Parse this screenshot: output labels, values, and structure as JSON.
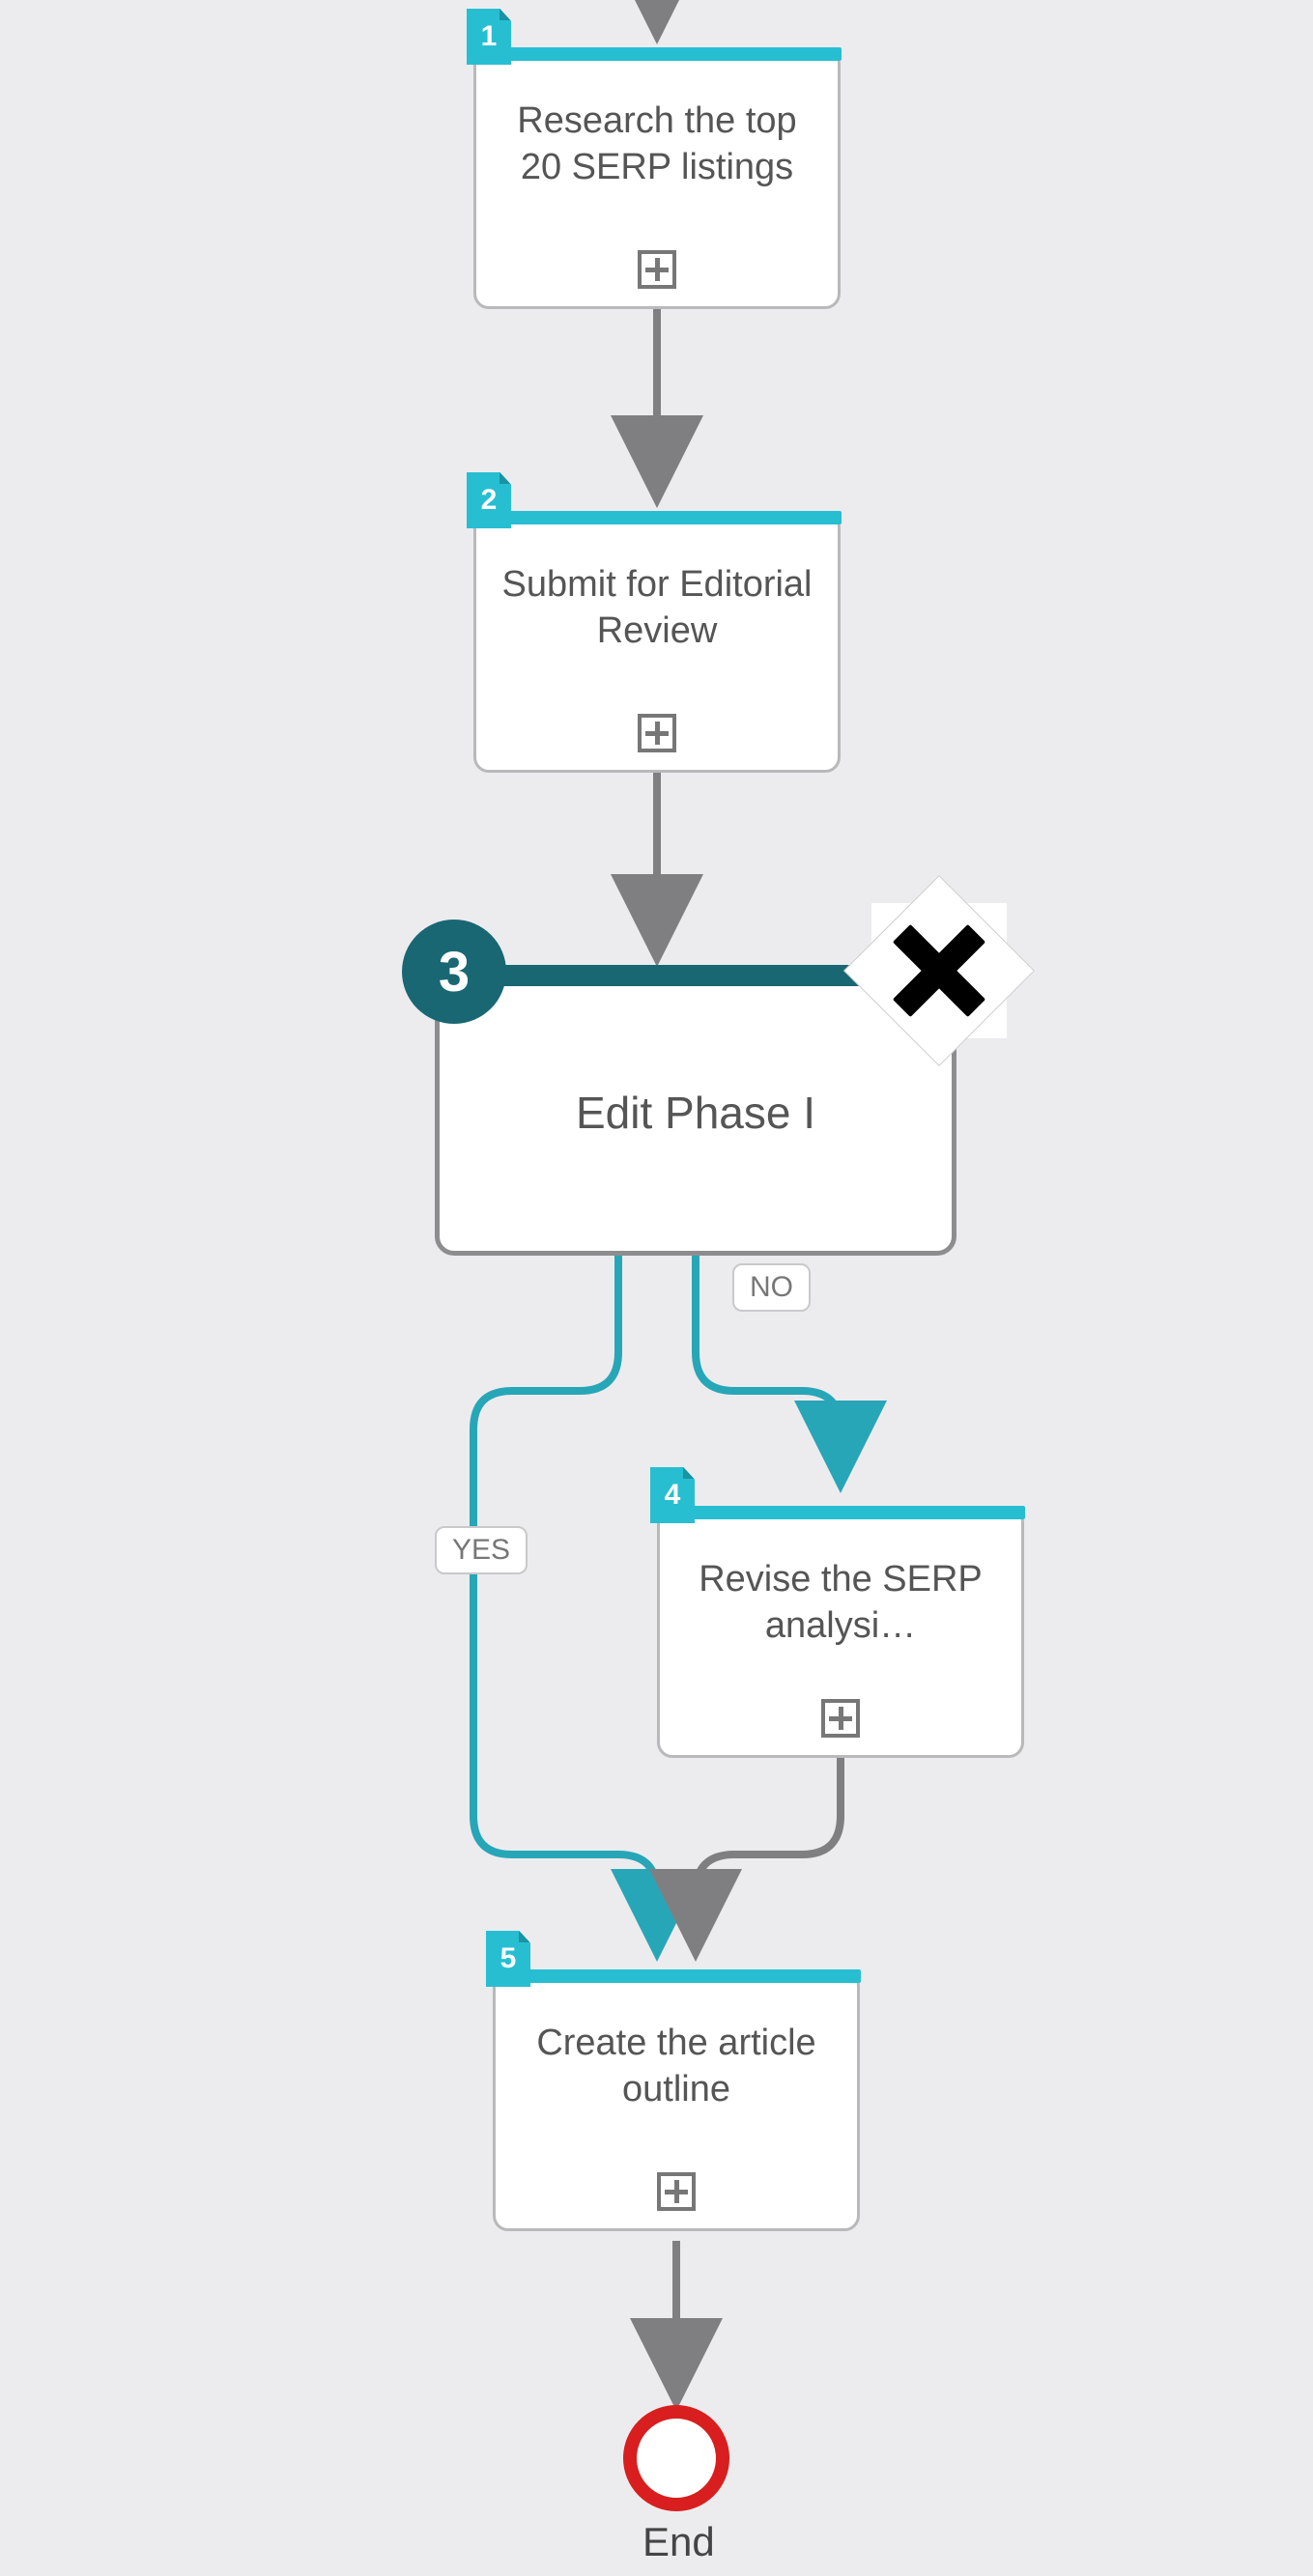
{
  "colors": {
    "accent": "#27bed2",
    "accent_dark": "#196773",
    "end_ring": "#d81e1e",
    "bg": "#ececee"
  },
  "nodes": {
    "n1": {
      "number": "1",
      "title": "Research the top 20 SERP listings"
    },
    "n2": {
      "number": "2",
      "title": "Submit for Editorial Review"
    },
    "n3": {
      "number": "3",
      "title": "Edit Phase I"
    },
    "n4": {
      "number": "4",
      "title": "Revise the SERP analysi…"
    },
    "n5": {
      "number": "5",
      "title": "Create the article outline"
    }
  },
  "edges": {
    "yes_label": "YES",
    "no_label": "NO"
  },
  "end": {
    "label": "End"
  }
}
